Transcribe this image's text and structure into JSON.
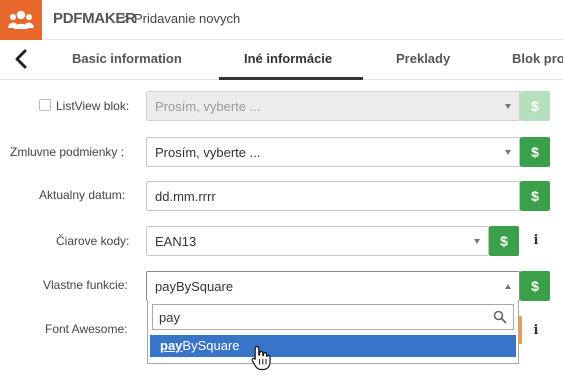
{
  "header": {
    "brand": "PDFMAKER",
    "separator": ">",
    "breadcrumb": "Pridavanie novych",
    "logo_icon": "users-group-icon",
    "accent_color": "#e8682c"
  },
  "tabs": [
    {
      "label": "Basic information",
      "active": false
    },
    {
      "label": "Iné informácie",
      "active": true
    },
    {
      "label": "Preklady",
      "active": false
    },
    {
      "label": "Blok pro",
      "active": false
    }
  ],
  "form": {
    "listview": {
      "label": "ListView blok:",
      "value": "Prosím, vyberte ...",
      "disabled": true,
      "checked": false
    },
    "zmluvne": {
      "label": "Zmluvne podmienky :",
      "value": "Prosím, vyberte ..."
    },
    "datum": {
      "label": "Aktualny datum:",
      "value": "dd.mm.rrrr"
    },
    "ciarove": {
      "label": "Čiarove kody:",
      "value": "EAN13"
    },
    "vlastne": {
      "label": "Vlastne funkcie:",
      "value": "payBySquare"
    },
    "fontawesome": {
      "label": "Font Awesome:"
    }
  },
  "buttons": {
    "dollar": "$",
    "info": "i"
  },
  "dropdown": {
    "search_value": "pay",
    "option_match": "pay",
    "option_rest": "BySquare"
  },
  "colors": {
    "green": "#3aa049",
    "green_disabled": "#b6e0bd",
    "highlight": "#3875c8"
  }
}
